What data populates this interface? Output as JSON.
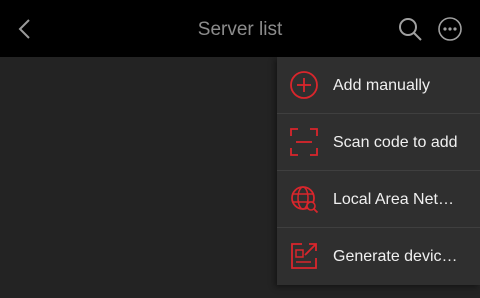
{
  "header": {
    "title": "Server list",
    "back_icon": "chevron-left-icon",
    "search_icon": "search-icon",
    "more_icon": "more-horizontal-icon"
  },
  "menu": {
    "items": [
      {
        "label": "Add manually",
        "icon": "add-circle-icon"
      },
      {
        "label": "Scan code to add",
        "icon": "scan-code-icon"
      },
      {
        "label": "Local Area Network",
        "icon": "globe-search-icon"
      },
      {
        "label": "Generate device QR code",
        "icon": "qr-export-icon"
      }
    ]
  },
  "colors": {
    "accent": "#d9262c",
    "header_bg": "#000000",
    "menu_bg": "#2f2f2f",
    "content_bg": "#232323",
    "title_text": "#8c8c8c",
    "menu_text": "#f0f0f0"
  }
}
